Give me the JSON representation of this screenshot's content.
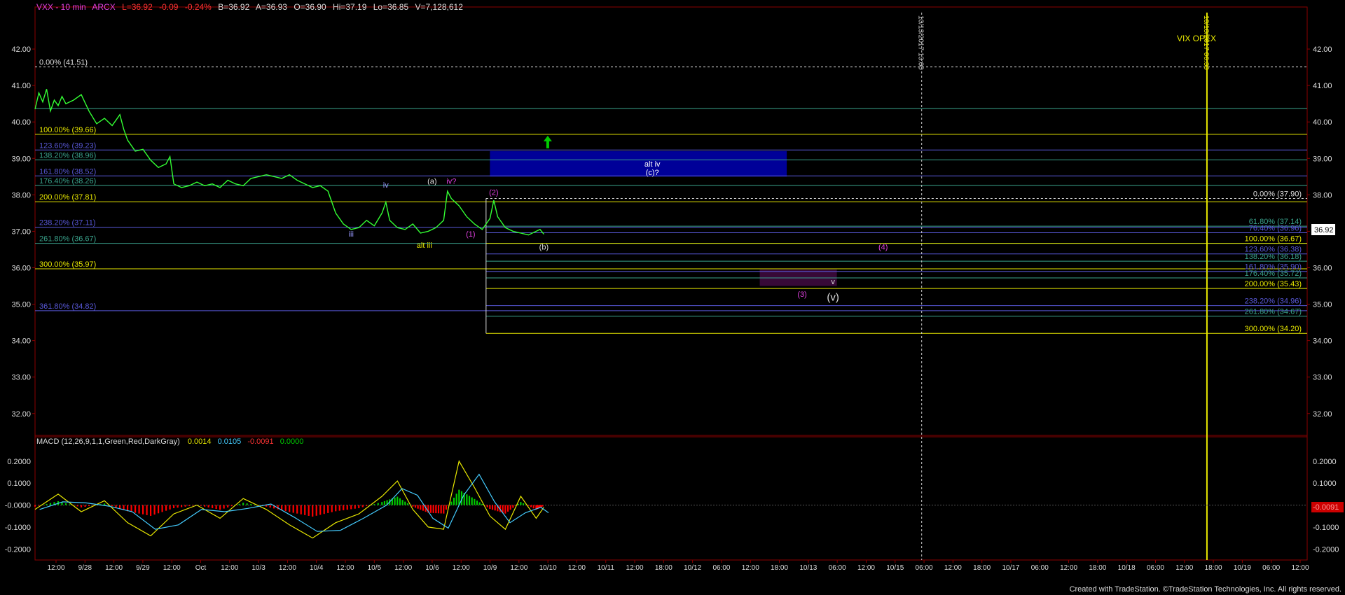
{
  "header": {
    "symbol": "VXX - 10 min",
    "exchange": "ARCX",
    "last": "L=36.92",
    "change": "-0.09",
    "change_pct": "-0.24%",
    "bid": "B=36.92",
    "ask": "A=36.93",
    "open": "O=36.90",
    "high": "Hi=37.19",
    "low": "Lo=36.85",
    "volume": "V=7,128,612"
  },
  "footer": {
    "credit": "Created with TradeStation. ©TradeStation Technologies, Inc. All rights reserved."
  },
  "colors": {
    "price": "#33ff33",
    "fib_yellow": "#e8e800",
    "fib_blue": "#5858d8",
    "fib_teal": "#3aa38c",
    "box_blue": "#0000a0",
    "box_purple": "#3a0a3a",
    "macd_pos": "#00cc00",
    "macd_neg": "#ff0000",
    "label_magenta": "#e040e0"
  },
  "chart_data": {
    "type": "line",
    "price_axis": {
      "ylim": [
        31.4,
        43.0
      ],
      "ticks": [
        "42.00",
        "41.00",
        "40.00",
        "39.00",
        "38.00",
        "37.00",
        "36.00",
        "35.00",
        "34.00",
        "33.00",
        "32.00"
      ],
      "current_price_label": "36.92"
    },
    "macd_axis": {
      "ylim": [
        -0.25,
        0.26
      ],
      "ticks": [
        "0.2000",
        "0.1000",
        "-0.0000",
        "-0.1000",
        "-0.2000"
      ],
      "current_value_label": "-0.0091"
    },
    "macd_header": {
      "title": "MACD (12,26,9,1,1,Green,Red,DarkGray)",
      "v1": "0.0014",
      "v2": "0.0105",
      "v3": "-0.0091",
      "v4": "0.0000"
    },
    "x_ticks": [
      "12:00",
      "9/28",
      "12:00",
      "9/29",
      "12:00",
      "Oct",
      "12:00",
      "10/3",
      "12:00",
      "10/4",
      "12:00",
      "10/5",
      "12:00",
      "10/6",
      "12:00",
      "10/9",
      "12:00",
      "10/10",
      "12:00",
      "10/11",
      "12:00",
      "18:00",
      "10/12",
      "06:00",
      "12:00",
      "18:00",
      "10/13",
      "06:00",
      "12:00",
      "10/15",
      "06:00",
      "12:00",
      "18:00",
      "10/17",
      "06:00",
      "12:00",
      "18:00",
      "10/18",
      "06:00",
      "12:00",
      "18:00",
      "10/19",
      "06:00",
      "12:00"
    ],
    "price_series": [
      [
        0,
        40.35
      ],
      [
        0.5,
        40.8
      ],
      [
        1,
        40.55
      ],
      [
        1.5,
        40.9
      ],
      [
        2,
        40.3
      ],
      [
        2.5,
        40.6
      ],
      [
        3,
        40.45
      ],
      [
        3.5,
        40.7
      ],
      [
        4,
        40.5
      ],
      [
        5,
        40.6
      ],
      [
        6,
        40.75
      ],
      [
        7,
        40.3
      ],
      [
        8,
        39.95
      ],
      [
        9,
        40.1
      ],
      [
        10,
        39.9
      ],
      [
        11,
        40.2
      ],
      [
        11.5,
        39.8
      ],
      [
        12,
        39.5
      ],
      [
        13,
        39.2
      ],
      [
        14,
        39.25
      ],
      [
        15,
        38.95
      ],
      [
        16,
        38.75
      ],
      [
        17,
        38.85
      ],
      [
        17.5,
        39.05
      ],
      [
        18,
        38.3
      ],
      [
        19,
        38.2
      ],
      [
        20,
        38.25
      ],
      [
        21,
        38.35
      ],
      [
        22,
        38.25
      ],
      [
        23,
        38.3
      ],
      [
        24,
        38.2
      ],
      [
        25,
        38.4
      ],
      [
        26,
        38.3
      ],
      [
        27,
        38.25
      ],
      [
        28,
        38.45
      ],
      [
        29,
        38.5
      ],
      [
        30,
        38.55
      ],
      [
        31,
        38.5
      ],
      [
        32,
        38.45
      ],
      [
        33,
        38.55
      ],
      [
        34,
        38.4
      ],
      [
        35,
        38.3
      ],
      [
        36,
        38.2
      ],
      [
        37,
        38.25
      ],
      [
        38,
        38.1
      ],
      [
        39,
        37.5
      ],
      [
        40,
        37.2
      ],
      [
        41,
        37.05
      ],
      [
        42,
        37.1
      ],
      [
        43,
        37.3
      ],
      [
        44,
        37.15
      ],
      [
        45,
        37.5
      ],
      [
        45.5,
        37.8
      ],
      [
        46,
        37.3
      ],
      [
        47,
        37.1
      ],
      [
        48,
        37.05
      ],
      [
        49,
        37.2
      ],
      [
        50,
        36.95
      ],
      [
        51,
        37.0
      ],
      [
        52,
        37.1
      ],
      [
        53,
        37.3
      ],
      [
        53.5,
        38.1
      ],
      [
        54,
        37.9
      ],
      [
        55,
        37.7
      ],
      [
        56,
        37.4
      ],
      [
        57,
        37.2
      ],
      [
        58,
        37.05
      ],
      [
        59,
        37.35
      ],
      [
        59.5,
        37.85
      ],
      [
        60,
        37.4
      ],
      [
        61,
        37.1
      ],
      [
        62,
        37.0
      ],
      [
        63,
        36.95
      ],
      [
        64,
        36.9
      ],
      [
        65,
        37.0
      ],
      [
        65.5,
        37.05
      ],
      [
        66,
        36.92
      ]
    ],
    "macd_series": [
      [
        0,
        -0.02
      ],
      [
        3,
        0.05
      ],
      [
        6,
        -0.03
      ],
      [
        9,
        0.02
      ],
      [
        12,
        -0.08
      ],
      [
        15,
        -0.14
      ],
      [
        18,
        -0.04
      ],
      [
        21,
        0.0
      ],
      [
        24,
        -0.06
      ],
      [
        27,
        0.03
      ],
      [
        30,
        -0.02
      ],
      [
        33,
        -0.09
      ],
      [
        36,
        -0.15
      ],
      [
        39,
        -0.08
      ],
      [
        42,
        -0.04
      ],
      [
        45,
        0.04
      ],
      [
        47,
        0.11
      ],
      [
        49,
        -0.02
      ],
      [
        51,
        -0.1
      ],
      [
        53,
        -0.11
      ],
      [
        55,
        0.2
      ],
      [
        57,
        0.08
      ],
      [
        59,
        -0.05
      ],
      [
        61,
        -0.11
      ],
      [
        63,
        0.04
      ],
      [
        65,
        -0.06
      ],
      [
        66,
        -0.01
      ]
    ],
    "fib_lines_left": [
      {
        "label": "0.00% (41.51)",
        "value": 41.51,
        "color": "#dddddd",
        "dashed": true
      },
      {
        "label": "100.00% (39.66)",
        "value": 39.66,
        "color": "#e8e800"
      },
      {
        "label": "123.60% (39.23)",
        "value": 39.23,
        "color": "#5858d8"
      },
      {
        "label": "138.20% (38.96)",
        "value": 38.96,
        "color": "#3aa38c"
      },
      {
        "label": "161.80% (38.52)",
        "value": 38.52,
        "color": "#5858d8"
      },
      {
        "label": "176.40% (38.26)",
        "value": 38.26,
        "color": "#3aa38c"
      },
      {
        "label": "200.00% (37.81)",
        "value": 37.81,
        "color": "#e8e800"
      },
      {
        "label": "238.20% (37.11)",
        "value": 37.11,
        "color": "#5858d8"
      },
      {
        "label": "261.80% (36.67)",
        "value": 36.67,
        "color": "#3aa38c"
      },
      {
        "label": "300.00% (35.97)",
        "value": 35.97,
        "color": "#e8e800"
      },
      {
        "label": "361.80% (34.82)",
        "value": 34.82,
        "color": "#5858d8"
      }
    ],
    "fib_lines_right": [
      {
        "label": "0.00% (37.90)",
        "value": 37.9,
        "color": "#dddddd",
        "dashed": true
      },
      {
        "label": "61.80% (37.14)",
        "value": 37.14,
        "color": "#3aa38c"
      },
      {
        "label": "76.40% (36.96)",
        "value": 36.96,
        "color": "#5858d8"
      },
      {
        "label": "100.00% (36.67)",
        "value": 36.67,
        "color": "#e8e800"
      },
      {
        "label": "123.60% (36.38)",
        "value": 36.38,
        "color": "#5858d8"
      },
      {
        "label": "138.20% (36.18)",
        "value": 36.18,
        "color": "#3aa38c"
      },
      {
        "label": "161.80% (35.90)",
        "value": 35.9,
        "color": "#5858d8"
      },
      {
        "label": "176.40% (35.72)",
        "value": 35.72,
        "color": "#3aa38c"
      },
      {
        "label": "200.00% (35.43)",
        "value": 35.43,
        "color": "#e8e800"
      },
      {
        "label": "238.20% (34.96)",
        "value": 34.96,
        "color": "#5858d8"
      },
      {
        "label": "261.80% (34.67)",
        "value": 34.67,
        "color": "#3aa38c"
      },
      {
        "label": "300.00% (34.20)",
        "value": 34.2,
        "color": "#e8e800"
      }
    ],
    "extra_line_value": 40.37,
    "zones": [
      {
        "name": "alt-iv-zone",
        "x0": 59.0,
        "x1": 97.5,
        "y0": 39.2,
        "y1": 38.5,
        "label": "alt iv",
        "label2": "(c)?"
      },
      {
        "name": "wave-3-zone",
        "x0": 94.0,
        "x1": 104.0,
        "y0": 35.95,
        "y1": 35.5
      }
    ],
    "wave_labels": [
      {
        "text": "iii",
        "x": 41,
        "y": 36.85,
        "color": "#9999ff"
      },
      {
        "text": "iv",
        "x": 45.5,
        "y": 38.2,
        "color": "#9999ff"
      },
      {
        "text": "(a)",
        "x": 51.5,
        "y": 38.3,
        "color": "#dddddd"
      },
      {
        "text": "iv?",
        "x": 54,
        "y": 38.3,
        "color": "#e040e0"
      },
      {
        "text": "alt iii",
        "x": 50.5,
        "y": 36.55,
        "color": "#e8e800"
      },
      {
        "text": "(1)",
        "x": 56.5,
        "y": 36.85,
        "color": "#e040e0"
      },
      {
        "text": "(2)",
        "x": 59.5,
        "y": 38.0,
        "color": "#e040e0"
      },
      {
        "text": "(b)",
        "x": 66,
        "y": 36.5,
        "color": "#dddddd"
      },
      {
        "text": "(3)",
        "x": 99.5,
        "y": 35.2,
        "color": "#e040e0"
      },
      {
        "text": "v",
        "x": 103.5,
        "y": 35.55,
        "color": "#dddddd"
      },
      {
        "text": "(v)",
        "x": 103.5,
        "y": 35.1,
        "color": "#dddddd"
      },
      {
        "text": "(4)",
        "x": 110,
        "y": 36.5,
        "color": "#e040e0"
      }
    ],
    "vertical_markers": [
      {
        "label": "10/13/2017 13:00",
        "x": 115,
        "color": "#cccccc",
        "dashed": true
      },
      {
        "label": "10/18/2017 06:30",
        "x": 152,
        "color": "#e8e800",
        "dashed": false
      }
    ],
    "annotation": "VIX OPEX"
  }
}
